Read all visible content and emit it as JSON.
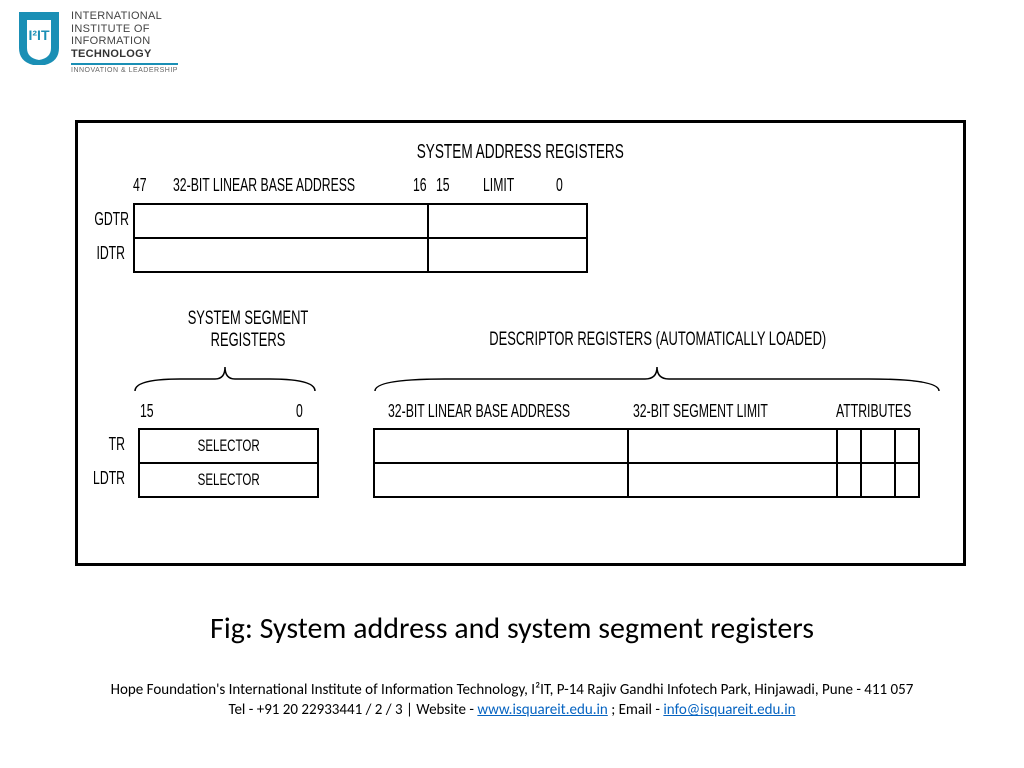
{
  "logo": {
    "line1": "INTERNATIONAL",
    "line2": "INSTITUTE OF",
    "line3": "INFORMATION",
    "line4": "TECHNOLOGY",
    "line5": "INNOVATION & LEADERSHIP",
    "badge": "I²IT"
  },
  "diagram": {
    "title_top": "SYSTEM ADDRESS REGISTERS",
    "bit47": "47",
    "base_addr_label": "32-BIT LINEAR BASE ADDRESS",
    "bit16": "16",
    "bit15a": "15",
    "limit_label": "LIMIT",
    "bit0a": "0",
    "gdtr": "GDTR",
    "idtr": "IDTR",
    "sys_seg_title_l1": "SYSTEM SEGMENT",
    "sys_seg_title_l2": "REGISTERS",
    "desc_reg_title": "DESCRIPTOR REGISTERS (AUTOMATICALLY LOADED)",
    "bit15b": "15",
    "bit0b": "0",
    "hdr_base2": "32-BIT LINEAR BASE ADDRESS",
    "hdr_seglim": "32-BIT SEGMENT LIMIT",
    "hdr_attr": "ATTRIBUTES",
    "tr": "TR",
    "ldtr": "LDTR",
    "selector": "SELECTOR"
  },
  "caption": "Fig: System address and system segment registers",
  "footer": {
    "line1": "Hope Foundation's International Institute of Information Technology, I²IT, P-14 Rajiv Gandhi Infotech Park, Hinjawadi, Pune - 411 057",
    "tel": "Tel - +91 20 22933441 / 2 / 3",
    "sep": "  |  ",
    "website_label": "Website - ",
    "website": "www.isquareit.edu.in",
    "email_label": " ; Email - ",
    "email": "info@isquareit.edu.in"
  }
}
